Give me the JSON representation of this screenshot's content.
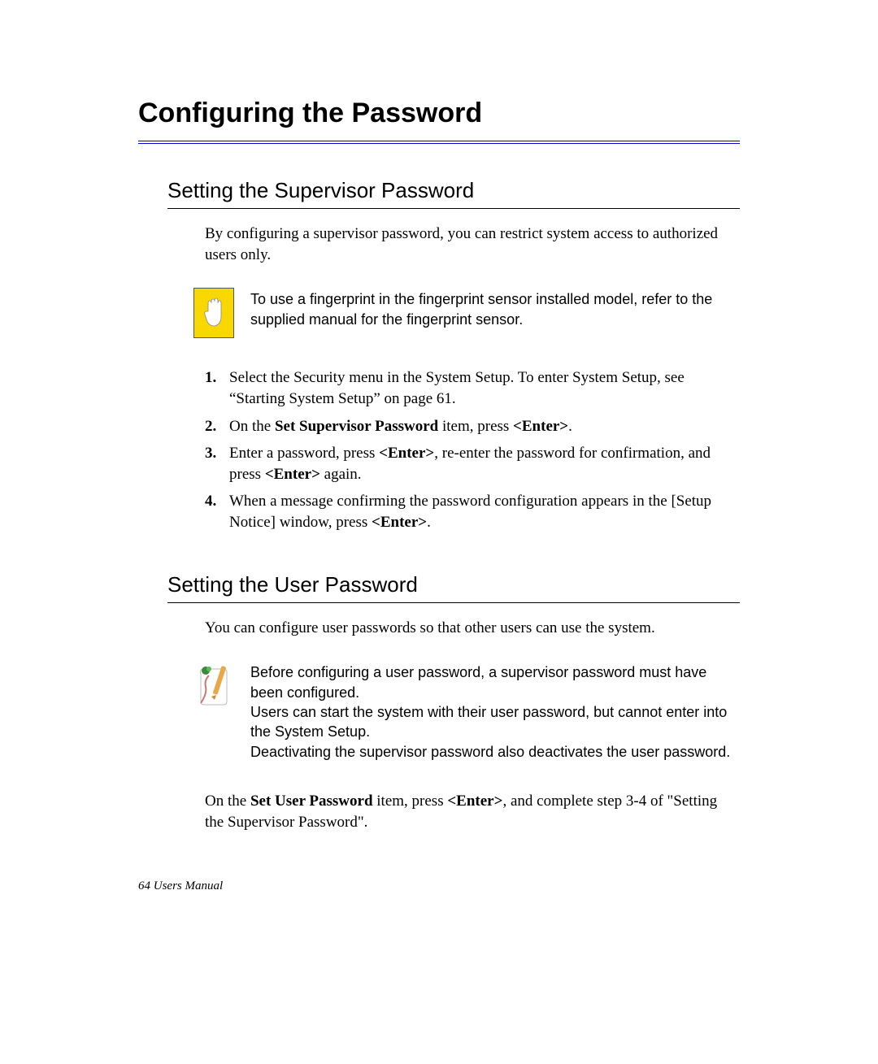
{
  "title": "Configuring the Password",
  "section1": {
    "heading": "Setting the Supervisor Password",
    "intro": "By configuring a supervisor password, you can restrict system access to authorized users only.",
    "note": "To use a fingerprint in the fingerprint sensor installed model, refer to the supplied manual for the fingerprint sensor.",
    "steps": [
      {
        "pre": "Select the Security menu in the System Setup. To enter System Setup, see “Starting System Setup” on page 61."
      },
      {
        "pre": "On the ",
        "b1": "Set Supervisor Password",
        "mid": " item, press ",
        "b2": "<Enter>",
        "end": "."
      },
      {
        "pre": "Enter a password, press ",
        "b1": "<Enter>",
        "mid": ", re-enter the password for confirmation, and press ",
        "b2": "<Enter>",
        "end": " again."
      },
      {
        "pre": "When a message confirming the password configuration appears in the [Setup Notice] window, press ",
        "b1": "<Enter>",
        "end": "."
      }
    ]
  },
  "section2": {
    "heading": "Setting the User Password",
    "intro": "You can configure user passwords so that other users can use the system.",
    "note1": "Before configuring a user password, a supervisor password must have been configured.",
    "note2": "Users can start the system with their user password, but cannot enter into the System Setup.",
    "note3": "Deactivating the supervisor password also deactivates the user password.",
    "endPre": "On the ",
    "endB1": "Set User Password",
    "endMid": " item, press ",
    "endB2": "<Enter>",
    "endPost": ", and complete step 3-4 of \"Setting the Supervisor Password\"."
  },
  "footer": "64  Users Manual"
}
